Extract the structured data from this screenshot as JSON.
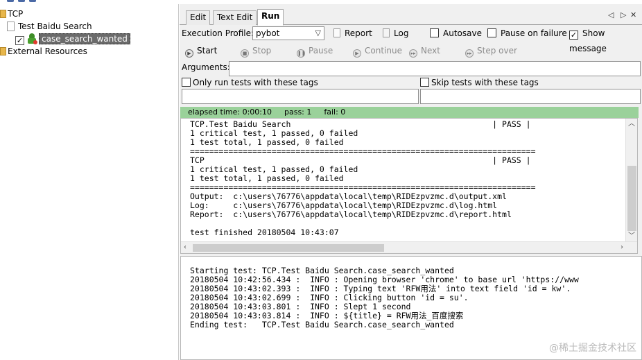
{
  "tree": {
    "root": "TCP",
    "suite": "Test Baidu Search",
    "testcase": "case_search_wanted",
    "external": "External Resources"
  },
  "tabs": [
    "Edit",
    "Text Edit",
    "Run"
  ],
  "tab_controls": {
    "prev": "◁",
    "next": "▷",
    "close": "✕"
  },
  "run": {
    "execution_profile_label": "Execution Profile:",
    "profile_value": "pybot",
    "report_label": "Report",
    "log_label": "Log",
    "autosave_label": "Autosave",
    "pause_on_failure_label": "Pause on failure",
    "show_message_label": "Show message",
    "buttons": {
      "start": "Start",
      "stop": "Stop",
      "pause": "Pause",
      "continue": "Continue",
      "next": "Next",
      "step_over": "Step over"
    },
    "arguments_label": "Arguments:",
    "only_run_tags_label": "Only run tests with these tags",
    "skip_tags_label": "Skip tests with these tags"
  },
  "status": {
    "elapsed": "elapsed time: 0:00:10",
    "pass": "pass: 1",
    "fail": "fail: 0",
    "color": "#9ad19a"
  },
  "output_lines": [
    "TCP.Test Baidu Search                                          | PASS |",
    "1 critical test, 1 passed, 0 failed",
    "1 test total, 1 passed, 0 failed",
    "========================================================================",
    "TCP                                                            | PASS |",
    "1 critical test, 1 passed, 0 failed",
    "1 test total, 1 passed, 0 failed",
    "========================================================================",
    "Output:  c:\\users\\76776\\appdata\\local\\temp\\RIDEzpvzmc.d\\output.xml",
    "Log:     c:\\users\\76776\\appdata\\local\\temp\\RIDEzpvzmc.d\\log.html",
    "Report:  c:\\users\\76776\\appdata\\local\\temp\\RIDEzpvzmc.d\\report.html",
    "",
    "test finished 20180504 10:43:07"
  ],
  "log_lines": [
    "Starting test: TCP.Test Baidu Search.case_search_wanted",
    "20180504 10:42:56.434 :  INFO : Opening browser 'chrome' to base url 'https://www",
    "20180504 10:43:02.393 :  INFO : Typing text 'RFW用法' into text field 'id = kw'.",
    "20180504 10:43:02.699 :  INFO : Clicking button 'id = su'.",
    "20180504 10:43:03.801 :  INFO : Slept 1 second",
    "20180504 10:43:03.814 :  INFO : ${title} = RFW用法_百度搜索",
    "Ending test:   TCP.Test Baidu Search.case_search_wanted"
  ],
  "watermark": "@稀土掘金技术社区"
}
